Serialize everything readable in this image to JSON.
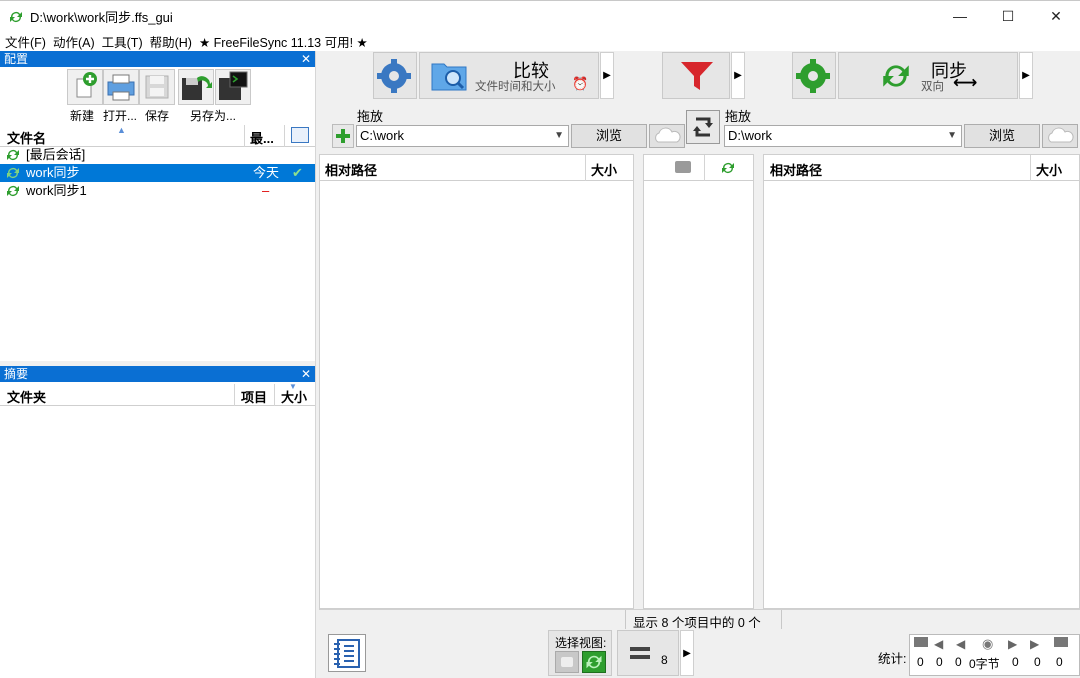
{
  "window": {
    "title": "D:\\work\\work同步.ffs_gui",
    "minimize": "—",
    "maximize": "☐",
    "close": "✕"
  },
  "menu": [
    "文件(F)",
    "动作(A)",
    "工具(T)",
    "帮助(H)",
    "★ FreeFileSync 11.13 可用! ★"
  ],
  "config_panel": {
    "title": "配置",
    "toolbar": [
      {
        "label": "新建",
        "icon": "new-config-icon"
      },
      {
        "label": "打开...",
        "icon": "printer-icon"
      },
      {
        "label": "保存",
        "icon": "save-icon"
      },
      {
        "label": "另存为...",
        "icon": "save-as-icon"
      }
    ],
    "columns": {
      "name": "文件名",
      "last": "最..."
    },
    "items": [
      {
        "name": "[最后会话]",
        "last": "",
        "status": ""
      },
      {
        "name": "work同步",
        "last": "今天",
        "status": "ok"
      },
      {
        "name": "work同步1",
        "last": "–",
        "status": ""
      }
    ]
  },
  "summary_panel": {
    "title": "摘要",
    "columns": {
      "folder": "文件夹",
      "items": "项目",
      "size": "大小"
    }
  },
  "compare": {
    "label": "比较",
    "sub": "文件时间和大小"
  },
  "sync": {
    "label": "同步",
    "sub": "双向"
  },
  "left_folder": {
    "label": "拖放",
    "path": "C:\\work",
    "browse": "浏览"
  },
  "right_folder": {
    "label": "拖放",
    "path": "D:\\work",
    "browse": "浏览"
  },
  "left_grid": {
    "col_path": "相对路径",
    "col_size": "大小"
  },
  "right_grid": {
    "col_path": "相对路径",
    "col_size": "大小"
  },
  "status": {
    "text": "显示 8 个项目中的 0 个"
  },
  "bottom": {
    "view_label": "选择视图:",
    "count": "8",
    "stats_label": "统计:",
    "stats": [
      "0",
      "0",
      "0",
      "0字节",
      "0",
      "0",
      "0"
    ]
  },
  "colors": {
    "accent": "#0078d7",
    "panel_head": "#0a6fd3",
    "filter_red": "#d7262c",
    "sync_green": "#2e9e2e",
    "gear_blue": "#3a78c2"
  }
}
